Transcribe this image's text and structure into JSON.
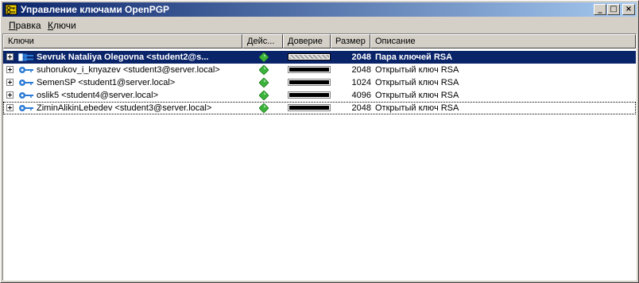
{
  "window": {
    "title": "Управление ключами OpenPGP",
    "controls": {
      "minimize": "_",
      "maximize": "□",
      "close": "×"
    }
  },
  "menu": [
    {
      "label": "Правка",
      "underline": "П",
      "rest": "равка"
    },
    {
      "label": "Ключи",
      "underline": "К",
      "rest": "лючи"
    }
  ],
  "columns": {
    "keys": "Ключи",
    "validity": "Дейс...",
    "trust": "Доверие",
    "size": "Размер",
    "description": "Описание"
  },
  "rows": [
    {
      "name": "Sevruk Nataliya Olegovna <student2@s...",
      "size": "2048",
      "description": "Пара ключей RSA",
      "trust_level": 1.0,
      "selected": true,
      "key_type": "pair-icon"
    },
    {
      "name": "suhorukov_i_knyazev <student3@server.local>",
      "size": "2048",
      "description": "Открытый ключ RSA",
      "trust_level": 1.0,
      "selected": false,
      "key_type": "key-icon"
    },
    {
      "name": "SemenSP <student1@server.local>",
      "size": "1024",
      "description": "Открытый ключ RSA",
      "trust_level": 1.0,
      "selected": false,
      "key_type": "key-icon"
    },
    {
      "name": "oslik5 <student4@server.local>",
      "size": "4096",
      "description": "Открытый ключ RSA",
      "trust_level": 1.0,
      "selected": false,
      "key_type": "key-icon"
    },
    {
      "name": "ZiminAlikinLebedev <student3@server.local>",
      "size": "2048",
      "description": "Открытый ключ RSA",
      "trust_level": 1.0,
      "selected": false,
      "key_type": "key-icon"
    }
  ],
  "colors": {
    "title_start": "#0a246a",
    "title_end": "#a6caf0",
    "selection": "#0a246a",
    "validity": "#3cb43c",
    "key_blue": "#2b7bd6"
  }
}
